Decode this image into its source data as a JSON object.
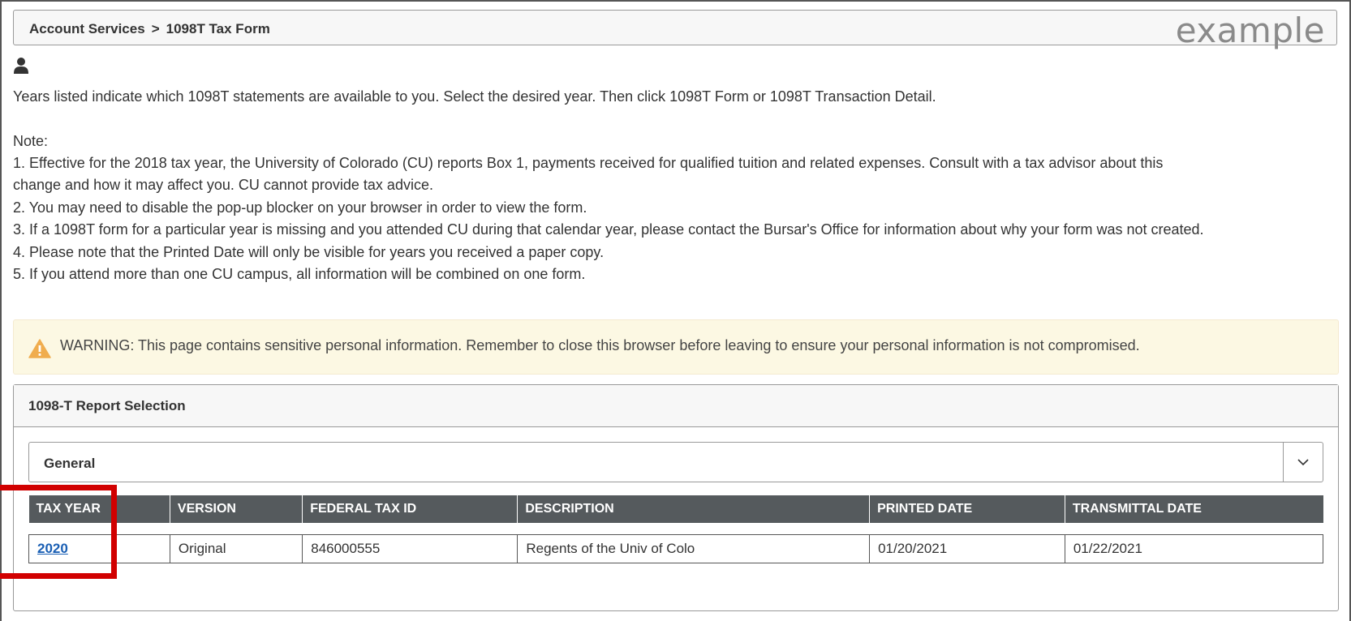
{
  "breadcrumb": {
    "parent": "Account Services",
    "separator": ">",
    "current": "1098T Tax Form",
    "watermark": "example"
  },
  "icons": {
    "user": "user-icon",
    "warning": "warning-triangle-icon",
    "dropdown": "chevron-down-icon"
  },
  "intro": "Years listed indicate which 1098T statements are available to you. Select the desired year. Then click 1098T Form or 1098T Transaction Detail.",
  "note_label": "Note:",
  "notes": [
    "1.  Effective for the 2018 tax year, the University of Colorado (CU) reports Box 1, payments received for qualified tuition and related expenses. Consult with a tax advisor about this",
    "change and how it may affect you. CU cannot provide tax advice.",
    "2.  You may need to disable the pop-up blocker on your browser in order to view the form.",
    "3.  If a 1098T form for a particular year is missing and you attended CU during that calendar year, please contact the Bursar's Office for information about why your form was not created.",
    "4.  Please note that the Printed Date will only be visible for years you received a paper copy.",
    "5.  If you attend more than one CU campus, all information will be combined on one form."
  ],
  "warning": "WARNING: This page contains sensitive personal information. Remember to close this browser before leaving to ensure your personal information is not compromised.",
  "panel": {
    "title": "1098-T Report Selection",
    "select_value": "General",
    "columns": [
      "TAX YEAR",
      "VERSION",
      "FEDERAL TAX ID",
      "DESCRIPTION",
      "PRINTED DATE",
      "TRANSMITTAL DATE"
    ],
    "rows": [
      [
        "2020",
        "Original",
        "846000555",
        "Regents of the Univ of Colo",
        "01/20/2021",
        "01/22/2021"
      ]
    ]
  },
  "colors": {
    "table_header": "#555a5d",
    "link": "#1a5fb4",
    "highlight": "#d10000",
    "warning_bg": "#fcf8e3",
    "warning_icon": "#f0ad4e"
  }
}
